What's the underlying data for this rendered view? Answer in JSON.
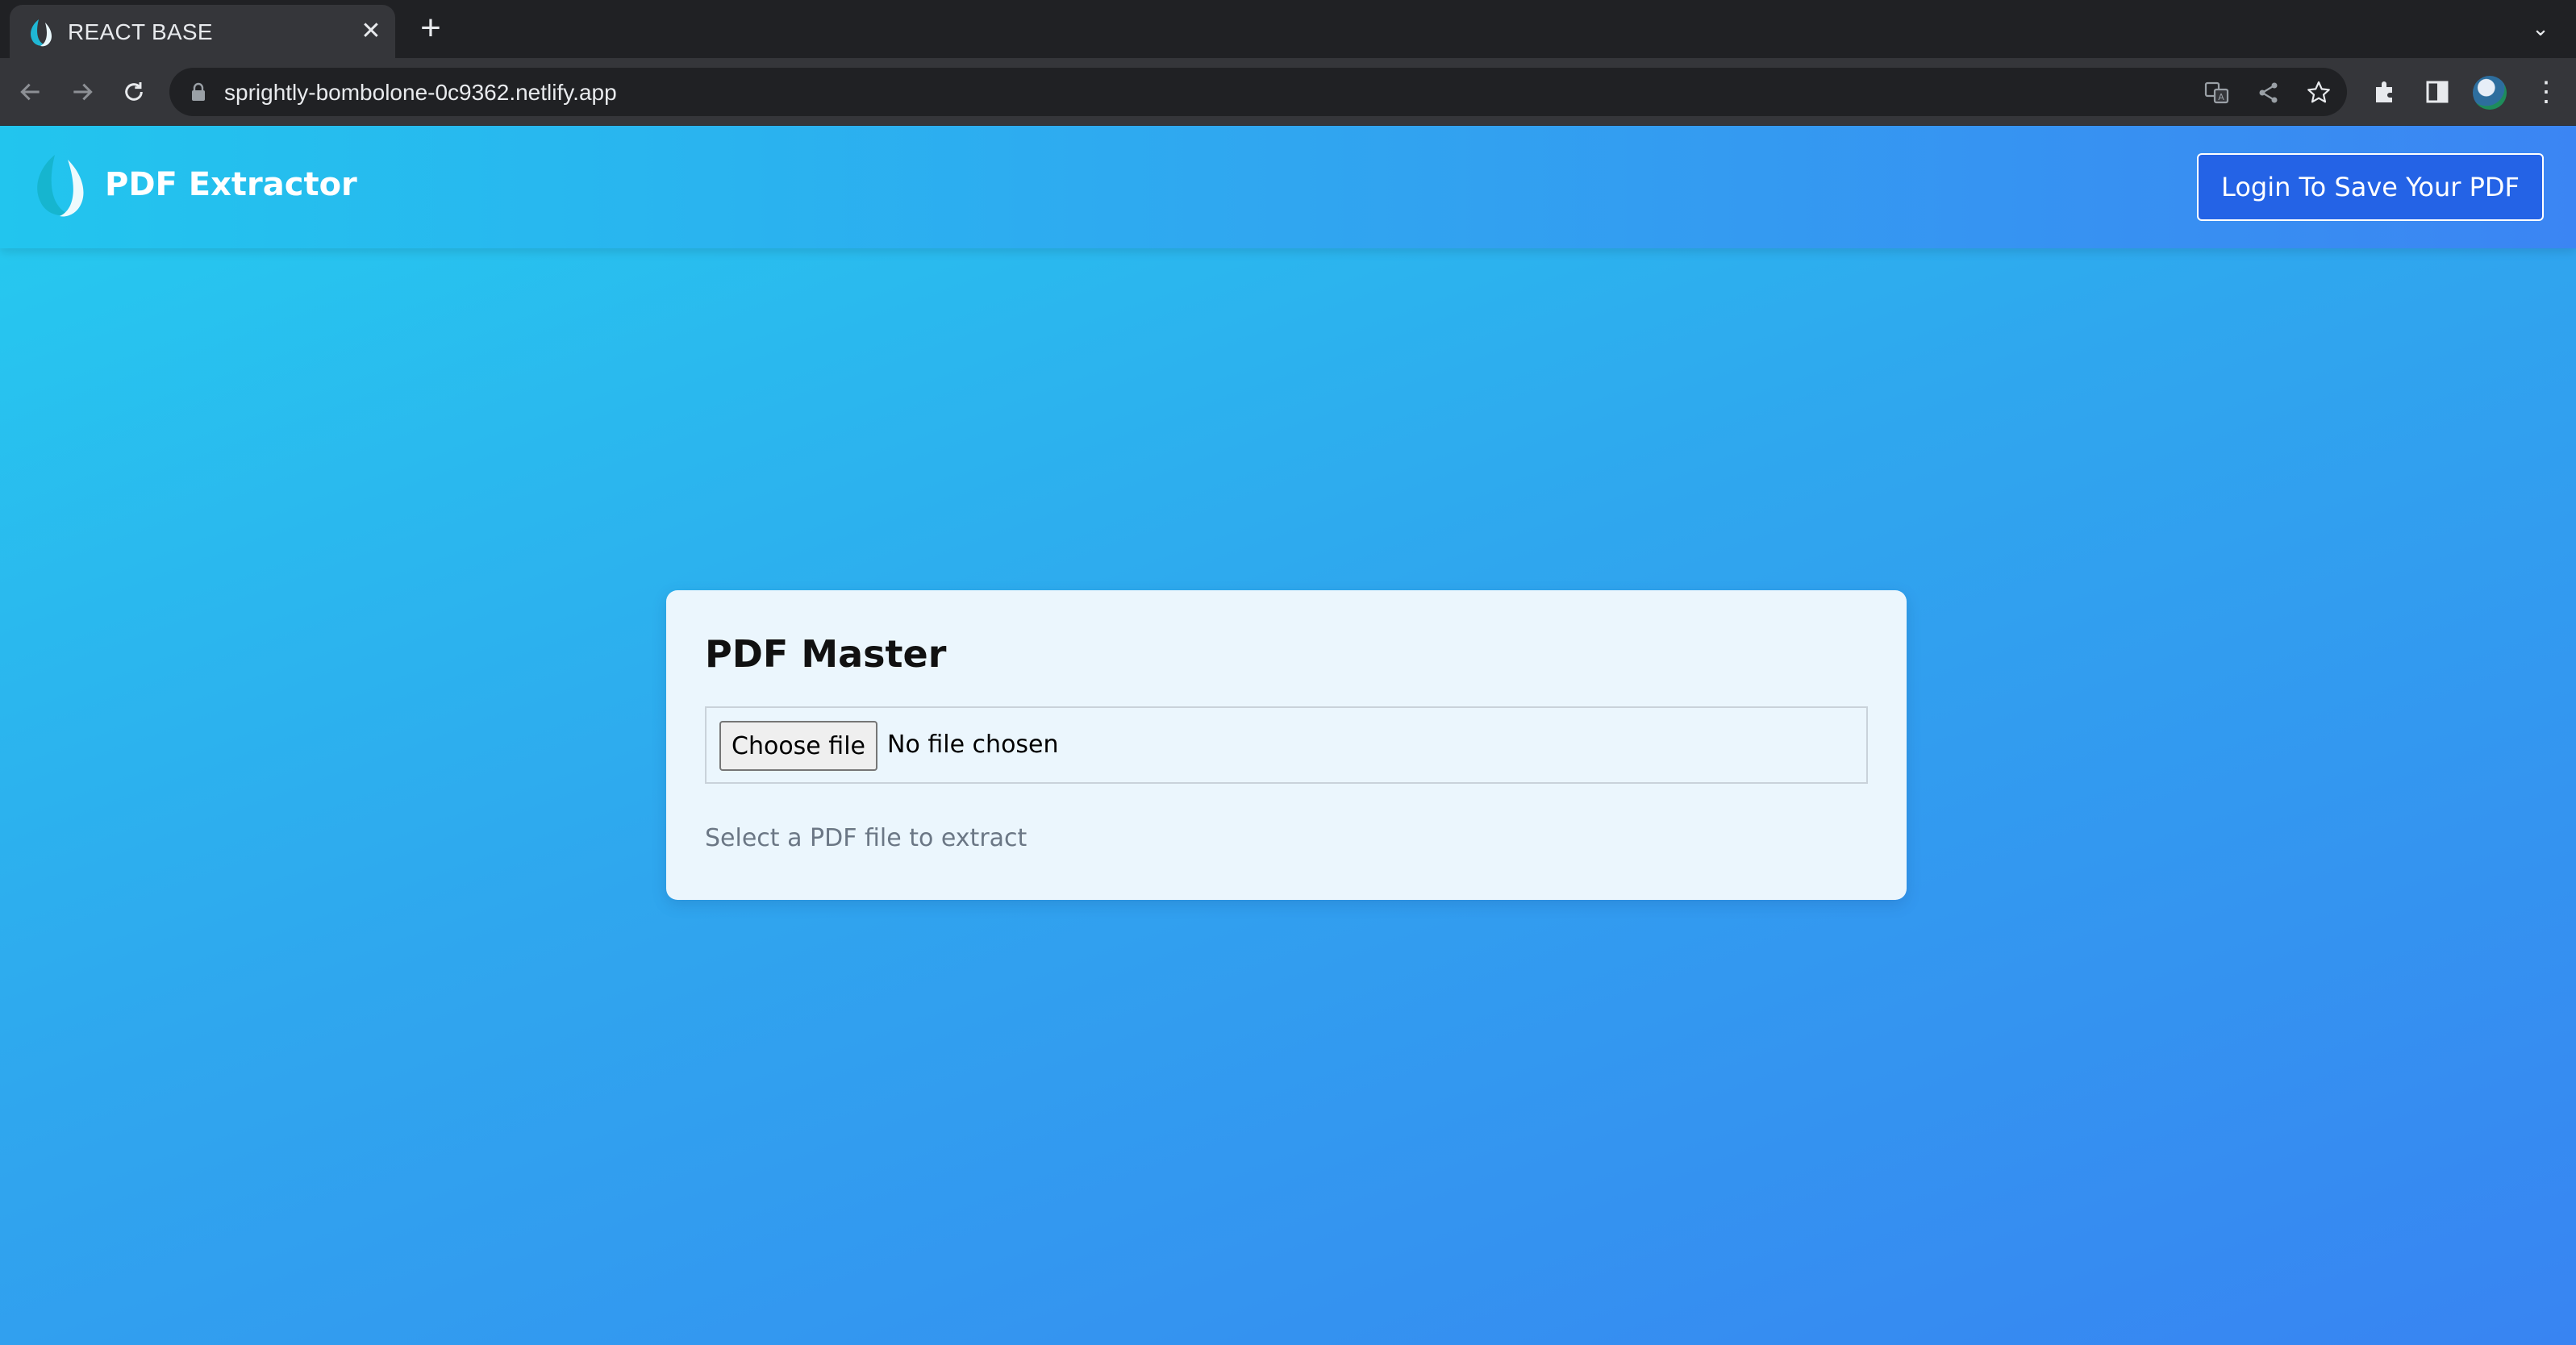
{
  "browser": {
    "tab": {
      "title": "REACT BASE",
      "close_glyph": "✕",
      "favicon": "drop-logo-icon"
    },
    "new_tab_glyph": "+",
    "tab_search_glyph": "⌄",
    "address_bar": {
      "url": "sprightly-bombolone-0c9362.netlify.app"
    },
    "menu_glyph": "⋮",
    "icons": [
      "back-icon",
      "forward-icon",
      "reload-icon",
      "lock-icon",
      "translate-icon",
      "share-icon",
      "bookmark-star-icon",
      "extensions-icon",
      "side-panel-icon",
      "profile-avatar",
      "menu-icon"
    ]
  },
  "navbar": {
    "brand_name": "PDF Extractor",
    "login_button": "Login To Save Your PDF"
  },
  "card": {
    "title": "PDF Master",
    "file_input": {
      "button_label": "Choose file",
      "status": "No file chosen"
    },
    "hint": "Select a PDF file to extract"
  },
  "colors": {
    "accent": "#2463e6",
    "gradient_start": "#25ccef",
    "gradient_end": "#3884f2",
    "card_bg": "#ebf6fd"
  }
}
